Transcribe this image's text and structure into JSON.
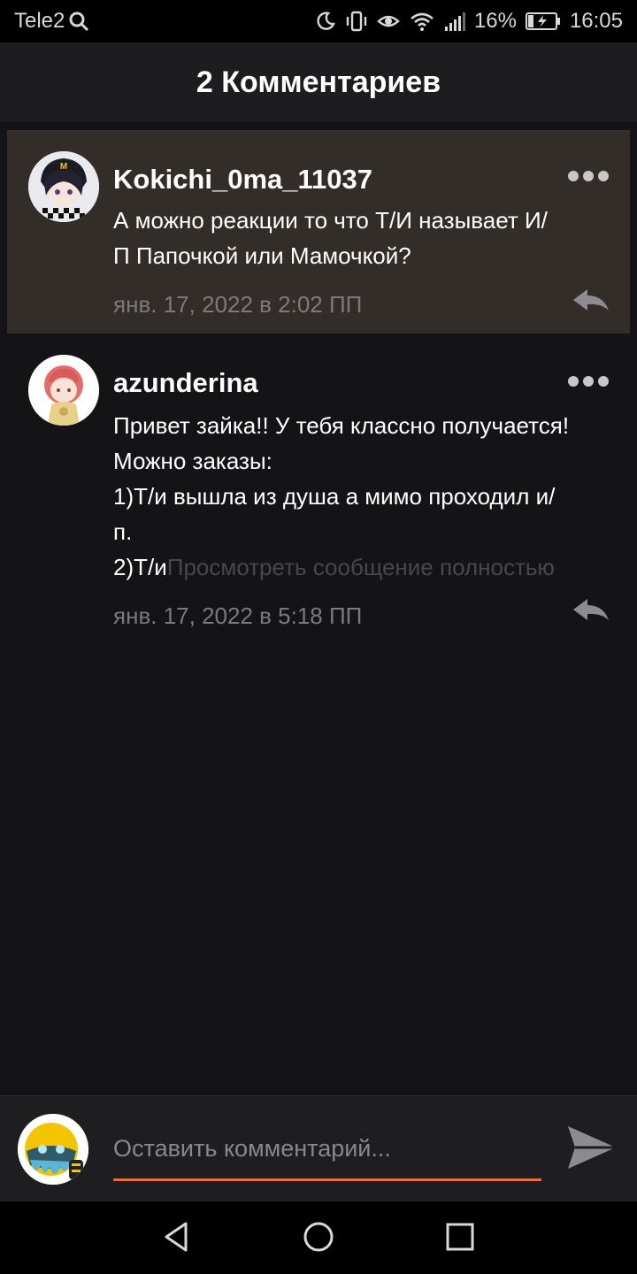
{
  "status_bar": {
    "carrier": "Tele2",
    "battery_percent": "16%",
    "time": "16:05",
    "icons": [
      "search-icon",
      "moon-icon",
      "vibrate-icon",
      "eye-icon",
      "wifi-icon",
      "signal-icon",
      "battery-charging-icon"
    ]
  },
  "header": {
    "title": "2 Комментариев"
  },
  "comments": [
    {
      "author": "Kokichi_0ma_11037",
      "lines": [
        "А можно реакции то что Т/И называет И/",
        "П Папочкой  или Мамочкой?"
      ],
      "date": "янв. 17, 2022 в 2:02 ПП",
      "highlighted": true
    },
    {
      "author": "azunderina",
      "lines": [
        "Привет зайка!! У тебя классно получается!",
        "Можно заказы:",
        "1)Т/и вышла из душа а мимо проходил и/",
        "п."
      ],
      "last_line_start": "2)Т/и",
      "read_more": "Просмотреть сообщение полностью",
      "date": "янв. 17, 2022 в 5:18 ПП",
      "highlighted": false
    }
  ],
  "composer": {
    "placeholder": "Оставить комментарий..."
  },
  "colors": {
    "accent": "#ee6a3c",
    "background": "#141316",
    "highlight": "#332d29",
    "secondary_text": "#7c797d"
  }
}
